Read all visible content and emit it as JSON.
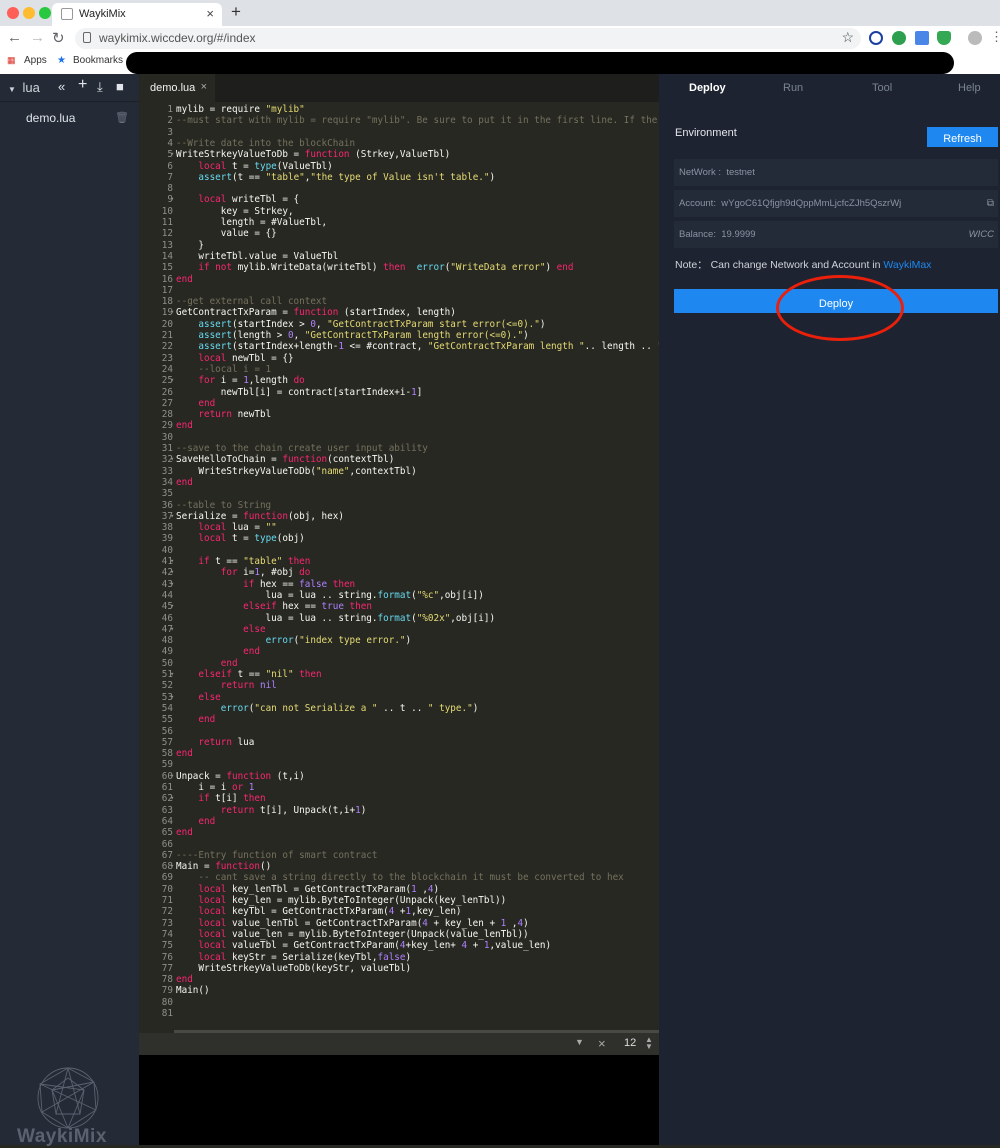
{
  "browser": {
    "tab_title": "WaykiMix",
    "url": "waykimix.wiccdev.org/#/index",
    "bookmarks": [
      "Apps",
      "Bookmarks"
    ]
  },
  "sidebar": {
    "folder": "lua",
    "files": [
      "demo.lua"
    ],
    "logo_text": "WaykiMix"
  },
  "editor": {
    "tab": "demo.lua",
    "font_size": "12",
    "lines": [
      [
        [
          "mylib = require ",
          ""
        ],
        [
          "\"mylib\"",
          "s"
        ]
      ],
      [
        [
          "--must start with mylib = require \"mylib\". Be sure to put it in the first line. If the first line",
          "c"
        ]
      ],
      [],
      [
        [
          "--Write date into the blockChain",
          "c"
        ]
      ],
      [
        [
          "WriteStrkeyValueToDb = ",
          ""
        ],
        [
          "function",
          "k"
        ],
        [
          " (Strkey,ValueTbl)",
          ""
        ]
      ],
      [
        [
          "    ",
          ""
        ],
        [
          "local",
          "k"
        ],
        [
          " t = ",
          ""
        ],
        [
          "type",
          "f"
        ],
        [
          "(ValueTbl)",
          ""
        ]
      ],
      [
        [
          "    ",
          ""
        ],
        [
          "assert",
          "f"
        ],
        [
          "(t == ",
          ""
        ],
        [
          "\"table\"",
          "s"
        ],
        [
          ",",
          ""
        ],
        [
          "\"the type of Value isn't table.\"",
          "s"
        ],
        [
          ")",
          ""
        ]
      ],
      [],
      [
        [
          "    ",
          ""
        ],
        [
          "local",
          "k"
        ],
        [
          " writeTbl = {",
          ""
        ]
      ],
      [
        [
          "        key = Strkey,",
          ""
        ]
      ],
      [
        [
          "        length = #ValueTbl,",
          ""
        ]
      ],
      [
        [
          "        value = {}",
          ""
        ]
      ],
      [
        [
          "    }",
          ""
        ]
      ],
      [
        [
          "    writeTbl.value = ValueTbl",
          ""
        ]
      ],
      [
        [
          "    ",
          ""
        ],
        [
          "if not",
          "k"
        ],
        [
          " mylib.WriteData(writeTbl) ",
          ""
        ],
        [
          "then",
          "k"
        ],
        [
          "  ",
          ""
        ],
        [
          "error",
          "f"
        ],
        [
          "(",
          ""
        ],
        [
          "\"WriteData error\"",
          "s"
        ],
        [
          ") ",
          ""
        ],
        [
          "end",
          "k"
        ]
      ],
      [
        [
          "end",
          "k"
        ]
      ],
      [],
      [
        [
          "--get external call context",
          "c"
        ]
      ],
      [
        [
          "GetContractTxParam = ",
          ""
        ],
        [
          "function",
          "k"
        ],
        [
          " (startIndex, length)",
          ""
        ]
      ],
      [
        [
          "    ",
          ""
        ],
        [
          "assert",
          "f"
        ],
        [
          "(startIndex > ",
          ""
        ],
        [
          "0",
          "n"
        ],
        [
          ", ",
          ""
        ],
        [
          "\"GetContractTxParam start error(<=0).\"",
          "s"
        ],
        [
          ")",
          ""
        ]
      ],
      [
        [
          "    ",
          ""
        ],
        [
          "assert",
          "f"
        ],
        [
          "(length > ",
          ""
        ],
        [
          "0",
          "n"
        ],
        [
          ", ",
          ""
        ],
        [
          "\"GetContractTxParam length error(<=0).\"",
          "s"
        ],
        [
          ")",
          ""
        ]
      ],
      [
        [
          "    ",
          ""
        ],
        [
          "assert",
          "f"
        ],
        [
          "(startIndex+length-",
          ""
        ],
        [
          "1",
          "n"
        ],
        [
          " <= #contract, ",
          ""
        ],
        [
          "\"GetContractTxParam length \"",
          "s"
        ],
        [
          ".. length .. ",
          ""
        ],
        [
          "\" exceeds",
          "s"
        ]
      ],
      [
        [
          "    ",
          ""
        ],
        [
          "local",
          "k"
        ],
        [
          " newTbl = {}",
          ""
        ]
      ],
      [
        [
          "    --local i = 1",
          "c"
        ]
      ],
      [
        [
          "    ",
          ""
        ],
        [
          "for",
          "k"
        ],
        [
          " i = ",
          ""
        ],
        [
          "1",
          "n"
        ],
        [
          ",length ",
          ""
        ],
        [
          "do",
          "k"
        ]
      ],
      [
        [
          "        newTbl[i] = contract[startIndex+i-",
          ""
        ],
        [
          "1",
          "n"
        ],
        [
          "]",
          ""
        ]
      ],
      [
        [
          "    ",
          ""
        ],
        [
          "end",
          "k"
        ]
      ],
      [
        [
          "    ",
          ""
        ],
        [
          "return",
          "k"
        ],
        [
          " newTbl",
          ""
        ]
      ],
      [
        [
          "end",
          "k"
        ]
      ],
      [],
      [
        [
          "--save to the chain create user input ability",
          "c"
        ]
      ],
      [
        [
          "SaveHelloToChain = ",
          ""
        ],
        [
          "function",
          "k"
        ],
        [
          "(contextTbl)",
          ""
        ]
      ],
      [
        [
          "    WriteStrkeyValueToDb(",
          ""
        ],
        [
          "\"name\"",
          "s"
        ],
        [
          ",contextTbl)",
          ""
        ]
      ],
      [
        [
          "end",
          "k"
        ]
      ],
      [],
      [
        [
          "--table to String",
          "c"
        ]
      ],
      [
        [
          "Serialize = ",
          ""
        ],
        [
          "function",
          "k"
        ],
        [
          "(obj, hex)",
          ""
        ]
      ],
      [
        [
          "    ",
          ""
        ],
        [
          "local",
          "k"
        ],
        [
          " lua = ",
          ""
        ],
        [
          "\"\"",
          "s"
        ]
      ],
      [
        [
          "    ",
          ""
        ],
        [
          "local",
          "k"
        ],
        [
          " t = ",
          ""
        ],
        [
          "type",
          "f"
        ],
        [
          "(obj)",
          ""
        ]
      ],
      [],
      [
        [
          "    ",
          ""
        ],
        [
          "if",
          "k"
        ],
        [
          " t == ",
          ""
        ],
        [
          "\"table\"",
          "s"
        ],
        [
          " ",
          ""
        ],
        [
          "then",
          "k"
        ]
      ],
      [
        [
          "        ",
          ""
        ],
        [
          "for",
          "k"
        ],
        [
          " i=",
          ""
        ],
        [
          "1",
          "n"
        ],
        [
          ", #obj ",
          ""
        ],
        [
          "do",
          "k"
        ]
      ],
      [
        [
          "            ",
          ""
        ],
        [
          "if",
          "k"
        ],
        [
          " hex == ",
          ""
        ],
        [
          "false",
          "n"
        ],
        [
          " ",
          ""
        ],
        [
          "then",
          "k"
        ]
      ],
      [
        [
          "                lua = lua .. string.",
          ""
        ],
        [
          "format",
          "f"
        ],
        [
          "(",
          ""
        ],
        [
          "\"%c\"",
          "s"
        ],
        [
          ",obj[i])",
          ""
        ]
      ],
      [
        [
          "            ",
          ""
        ],
        [
          "elseif",
          "k"
        ],
        [
          " hex == ",
          ""
        ],
        [
          "true",
          "n"
        ],
        [
          " ",
          ""
        ],
        [
          "then",
          "k"
        ]
      ],
      [
        [
          "                lua = lua .. string.",
          ""
        ],
        [
          "format",
          "f"
        ],
        [
          "(",
          ""
        ],
        [
          "\"%02x\"",
          "s"
        ],
        [
          ",obj[i])",
          ""
        ]
      ],
      [
        [
          "            ",
          ""
        ],
        [
          "else",
          "k"
        ]
      ],
      [
        [
          "                ",
          ""
        ],
        [
          "error",
          "f"
        ],
        [
          "(",
          ""
        ],
        [
          "\"index type error.\"",
          "s"
        ],
        [
          ")",
          ""
        ]
      ],
      [
        [
          "            ",
          ""
        ],
        [
          "end",
          "k"
        ]
      ],
      [
        [
          "        ",
          ""
        ],
        [
          "end",
          "k"
        ]
      ],
      [
        [
          "    ",
          ""
        ],
        [
          "elseif",
          "k"
        ],
        [
          " t == ",
          ""
        ],
        [
          "\"nil\"",
          "s"
        ],
        [
          " ",
          ""
        ],
        [
          "then",
          "k"
        ]
      ],
      [
        [
          "        ",
          ""
        ],
        [
          "return",
          "k"
        ],
        [
          " ",
          ""
        ],
        [
          "nil",
          "n"
        ]
      ],
      [
        [
          "    ",
          ""
        ],
        [
          "else",
          "k"
        ]
      ],
      [
        [
          "        ",
          ""
        ],
        [
          "error",
          "f"
        ],
        [
          "(",
          ""
        ],
        [
          "\"can not Serialize a \"",
          "s"
        ],
        [
          " .. t .. ",
          ""
        ],
        [
          "\" type.\"",
          "s"
        ],
        [
          ")",
          ""
        ]
      ],
      [
        [
          "    ",
          ""
        ],
        [
          "end",
          "k"
        ]
      ],
      [],
      [
        [
          "    ",
          ""
        ],
        [
          "return",
          "k"
        ],
        [
          " lua",
          ""
        ]
      ],
      [
        [
          "end",
          "k"
        ]
      ],
      [],
      [
        [
          "Unpack = ",
          ""
        ],
        [
          "function",
          "k"
        ],
        [
          " (t,i)",
          ""
        ]
      ],
      [
        [
          "    i = i ",
          ""
        ],
        [
          "or",
          "k"
        ],
        [
          " ",
          ""
        ],
        [
          "1",
          "n"
        ]
      ],
      [
        [
          "    ",
          ""
        ],
        [
          "if",
          "k"
        ],
        [
          " t[i] ",
          ""
        ],
        [
          "then",
          "k"
        ]
      ],
      [
        [
          "        ",
          ""
        ],
        [
          "return",
          "k"
        ],
        [
          " t[i], Unpack(t,i+",
          ""
        ],
        [
          "1",
          "n"
        ],
        [
          ")",
          ""
        ]
      ],
      [
        [
          "    ",
          ""
        ],
        [
          "end",
          "k"
        ]
      ],
      [
        [
          "end",
          "k"
        ]
      ],
      [],
      [
        [
          "----Entry function of smart contract",
          "c"
        ]
      ],
      [
        [
          "Main = ",
          ""
        ],
        [
          "function",
          "k"
        ],
        [
          "()",
          ""
        ]
      ],
      [
        [
          "    -- cant save a string directly to the blockchain it must be converted to hex",
          "c"
        ]
      ],
      [
        [
          "    ",
          ""
        ],
        [
          "local",
          "k"
        ],
        [
          " key_lenTbl = GetContractTxParam(",
          ""
        ],
        [
          "1",
          "n"
        ],
        [
          " ,",
          ""
        ],
        [
          "4",
          "n"
        ],
        [
          ")",
          ""
        ]
      ],
      [
        [
          "    ",
          ""
        ],
        [
          "local",
          "k"
        ],
        [
          " key_len = mylib.ByteToInteger(Unpack(key_lenTbl))",
          ""
        ]
      ],
      [
        [
          "    ",
          ""
        ],
        [
          "local",
          "k"
        ],
        [
          " keyTbl = GetContractTxParam(",
          ""
        ],
        [
          "4",
          "n"
        ],
        [
          " +",
          ""
        ],
        [
          "1",
          "n"
        ],
        [
          ",key_len)",
          ""
        ]
      ],
      [
        [
          "    ",
          ""
        ],
        [
          "local",
          "k"
        ],
        [
          " value_lenTbl = GetContractTxParam(",
          ""
        ],
        [
          "4",
          "n"
        ],
        [
          " + key_len + ",
          ""
        ],
        [
          "1",
          "n"
        ],
        [
          " ,",
          ""
        ],
        [
          "4",
          "n"
        ],
        [
          ")",
          ""
        ]
      ],
      [
        [
          "    ",
          ""
        ],
        [
          "local",
          "k"
        ],
        [
          " value_len = mylib.ByteToInteger(Unpack(value_lenTbl))",
          ""
        ]
      ],
      [
        [
          "    ",
          ""
        ],
        [
          "local",
          "k"
        ],
        [
          " valueTbl = GetContractTxParam(",
          ""
        ],
        [
          "4",
          "n"
        ],
        [
          "+key_len+ ",
          ""
        ],
        [
          "4",
          "n"
        ],
        [
          " + ",
          ""
        ],
        [
          "1",
          "n"
        ],
        [
          ",value_len)",
          ""
        ]
      ],
      [
        [
          "    ",
          ""
        ],
        [
          "local",
          "k"
        ],
        [
          " keyStr = Serialize(keyTbl,",
          ""
        ],
        [
          "false",
          "n"
        ],
        [
          ")",
          ""
        ]
      ],
      [
        [
          "    WriteStrkeyValueToDb(keyStr, valueTbl)",
          ""
        ]
      ],
      [
        [
          "end",
          "k"
        ]
      ],
      [
        [
          "Main()",
          ""
        ]
      ],
      [],
      []
    ]
  },
  "panel": {
    "tabs": [
      "Deploy",
      "Run",
      "Tool",
      "Help"
    ],
    "environment_label": "Environment",
    "refresh_label": "Refresh",
    "network_label": "NetWork :  testnet",
    "account_label": "Account:  wYgoC61Qfjgh9dQppMmLjcfcZJh5QszrWj",
    "balance_label": "Balance:  19.9999",
    "balance_unit": "WICC",
    "note_prefix": "Note： Can change Network and Account in ",
    "note_link": "WaykiMax",
    "deploy_label": "Deploy"
  },
  "colors": {
    "accent": "#1e88f0",
    "annotation": "#e8200c"
  }
}
